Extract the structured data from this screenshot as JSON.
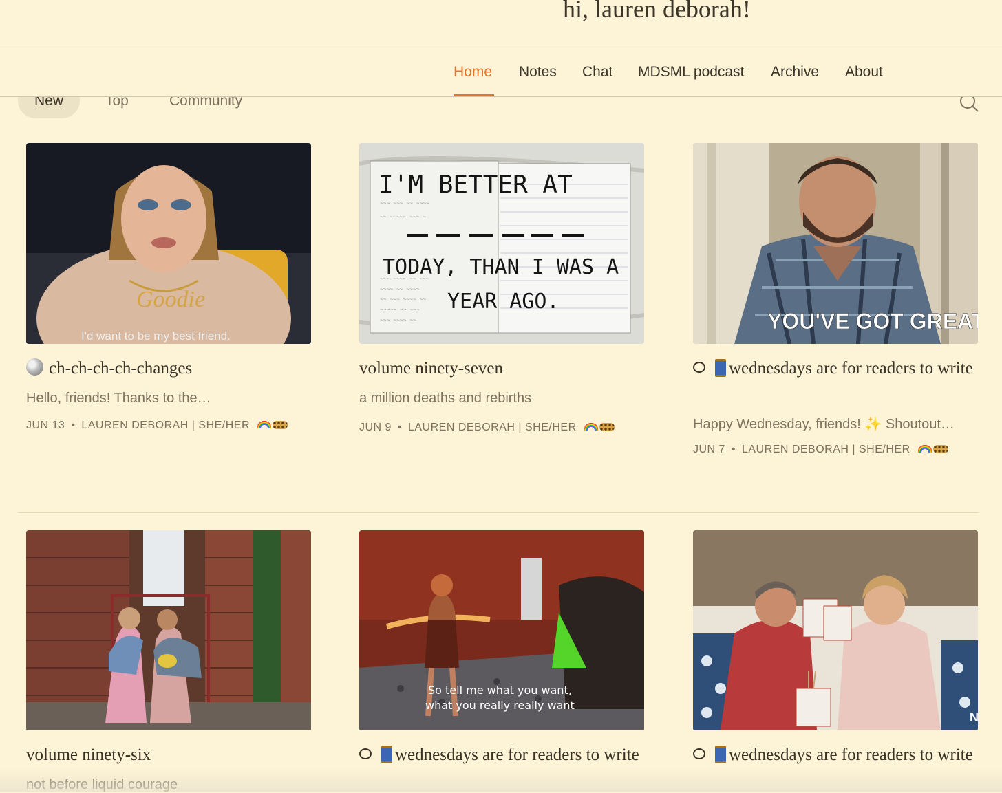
{
  "header": {
    "greeting": "hi, lauren deborah!"
  },
  "nav": {
    "items": [
      {
        "label": "Home",
        "active": true
      },
      {
        "label": "Notes"
      },
      {
        "label": "Chat"
      },
      {
        "label": "MDSML podcast"
      },
      {
        "label": "Archive"
      },
      {
        "label": "About"
      }
    ]
  },
  "filter_tabs": [
    {
      "label": "New",
      "selected": true
    },
    {
      "label": "Top"
    },
    {
      "label": "Community"
    }
  ],
  "search": {
    "icon": "search-icon"
  },
  "posts": [
    {
      "title": "ch-ch-ch-ch-changes",
      "title_icon": "disco-ball-icon",
      "subtitle": "Hello, friends! Thanks to the…",
      "date": "JUN 13",
      "author": "LAUREN DEBORAH | SHE/HER",
      "image_caption": "I'd want to be my best friend."
    },
    {
      "title": "volume ninety-seven",
      "subtitle": "a million deaths and rebirths",
      "date": "JUN 9",
      "author": "LAUREN DEBORAH | SHE/HER",
      "image_text": [
        "I'M BETTER AT",
        "TODAY, THAN I WAS A",
        "YEAR AGO."
      ]
    },
    {
      "title_part1": "wednesdays are for readers to",
      "title_part2": "write",
      "title_icons": [
        "comment-icon",
        "spool-of-thread-icon"
      ],
      "subtitle": "Happy Wednesday, friends! ✨ Shoutout…",
      "date": "JUN 7",
      "author": "LAUREN DEBORAH | SHE/HER",
      "image_caption": "YOU'VE GOT GREAT TASTE"
    },
    {
      "title": "volume ninety-six",
      "subtitle": "not before liquid courage"
    },
    {
      "title_part1": "wednesdays are for readers to",
      "title_part2": "write",
      "title_icons": [
        "comment-icon",
        "spool-of-thread-icon"
      ],
      "image_caption_1": "So tell me what you want,",
      "image_caption_2": "what you really really want"
    },
    {
      "title_part1": "wednesdays are for readers to",
      "title_part2": "write",
      "title_icons": [
        "comment-icon",
        "spool-of-thread-icon"
      ],
      "image_badge": "N"
    }
  ],
  "meta_separator": "•",
  "meta_icons": [
    "rainbow-icon",
    "leopard-icon"
  ],
  "colors": {
    "background": "#fdf3d6",
    "accent": "#e5742b",
    "text": "#3a3226",
    "muted": "#7b725f"
  }
}
